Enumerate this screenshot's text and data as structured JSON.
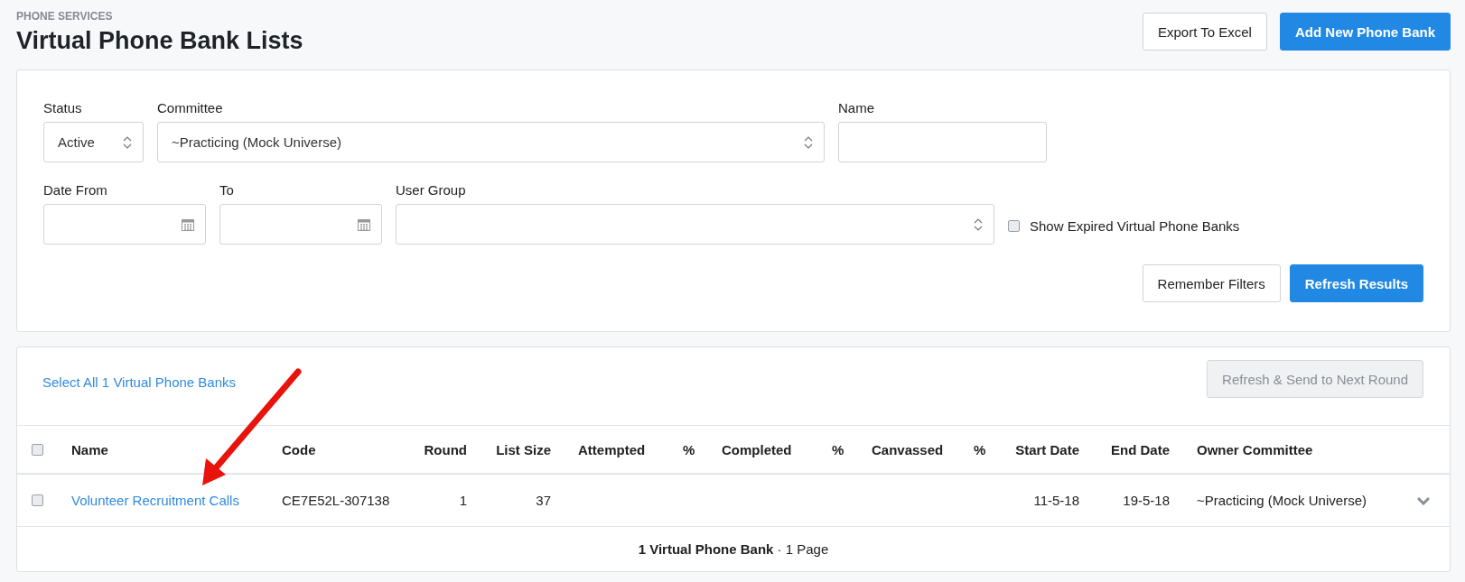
{
  "header": {
    "section": "PHONE SERVICES",
    "title": "Virtual Phone Bank Lists",
    "buttons": [
      {
        "label": "Export To Excel",
        "kind": "secondary"
      },
      {
        "label": "Add New Phone Bank",
        "kind": "primary"
      }
    ]
  },
  "filters": {
    "rows": [
      [
        {
          "label": "Status",
          "kind": "select",
          "value": "Active"
        },
        {
          "label": "Committee",
          "kind": "select",
          "value": "~Practicing (Mock Universe)"
        },
        {
          "label": "Name",
          "kind": "text"
        }
      ],
      [
        {
          "label": "Date From",
          "kind": "date"
        },
        {
          "label": "To",
          "kind": "date"
        },
        {
          "label": "User Group",
          "kind": "select"
        }
      ]
    ],
    "show_expired": {
      "label": "Show Expired Virtual Phone Banks",
      "checked": false
    },
    "buttons": [
      {
        "label": "Remember Filters",
        "kind": "secondary"
      },
      {
        "label": "Refresh Results",
        "kind": "primary"
      }
    ]
  },
  "results": {
    "select_all_link": "Select All 1 Virtual Phone Banks",
    "bulk_button": {
      "label": "Refresh & Send to Next Round",
      "disabled": true
    },
    "table": {
      "all_checked": false,
      "columns": [
        "Name",
        "Code",
        "Round",
        "List Size",
        "Attempted",
        "%",
        "Completed",
        "%",
        "Canvassed",
        "%",
        "Start Date",
        "End Date",
        "Owner Committee"
      ],
      "rows": [
        {
          "selected": false,
          "expanded": false,
          "name": "Volunteer Recruitment Calls",
          "code": "CE7E52L-307138",
          "round": "1",
          "list_size": "37",
          "start_date": "11-5-18",
          "end_date": "19-5-18",
          "owner_committee": "~Practicing (Mock Universe)"
        }
      ]
    },
    "summary": "**1 Virtual Phone Bank** · 1 Page"
  }
}
